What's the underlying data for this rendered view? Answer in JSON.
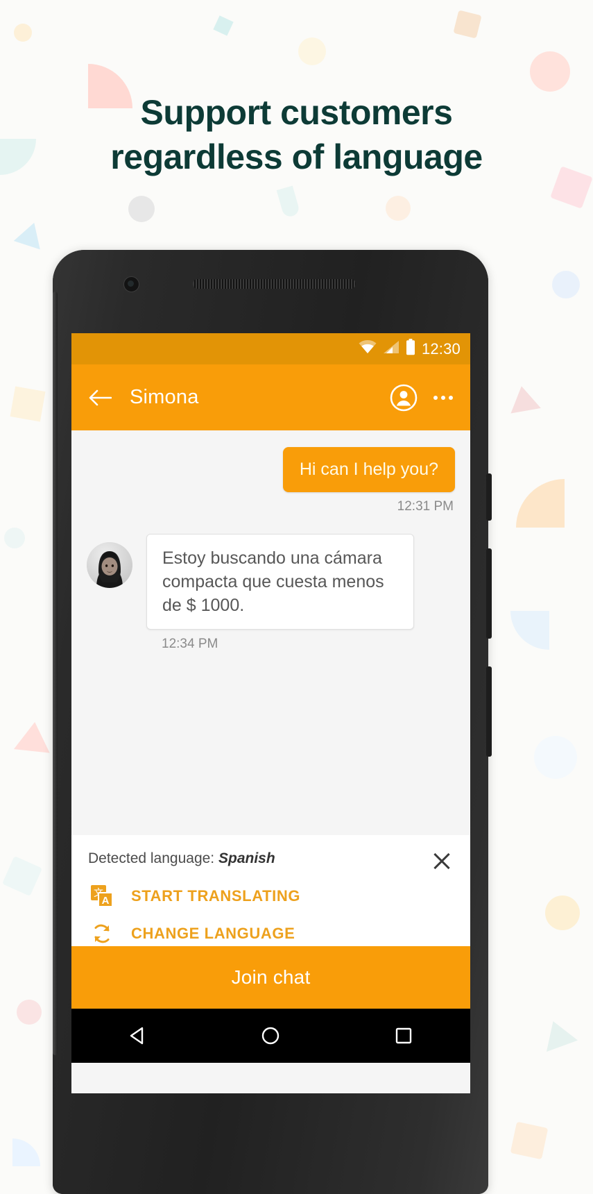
{
  "headline": {
    "line1": "Support customers",
    "line2": "regardless of language",
    "color": "#0d3b36"
  },
  "theme": {
    "accent": "#f99d09",
    "accent_dark": "#e29406",
    "link": "#eda11d",
    "page_bg": "#fbfbf9"
  },
  "phone": {
    "statusbar": {
      "time": "12:30",
      "icons": [
        "wifi-icon",
        "cell-signal-icon",
        "battery-icon"
      ]
    },
    "appbar": {
      "back_icon": "back-arrow-icon",
      "title": "Simona",
      "person_icon": "account-circle-icon",
      "overflow_icon": "more-vertical-icon"
    },
    "chat": {
      "messages": [
        {
          "direction": "outgoing",
          "text": "Hi can I help you?",
          "timestamp": "12:31 PM"
        },
        {
          "direction": "incoming",
          "text": "Estoy buscando una cámara compacta que cuesta menos de $ 1000.",
          "timestamp": "12:34 PM",
          "avatar": "contact-avatar"
        }
      ]
    },
    "translate_panel": {
      "detected_prefix": "Detected language: ",
      "detected_language": "Spanish",
      "close_icon": "close-icon",
      "actions": [
        {
          "icon": "google-translate-icon",
          "label": "START TRANSLATING"
        },
        {
          "icon": "swap-language-icon",
          "label": "CHANGE LANGUAGE"
        }
      ]
    },
    "join_button": "Join chat",
    "navbar": {
      "back_icon": "nav-back-triangle-icon",
      "home_icon": "nav-home-circle-icon",
      "recents_icon": "nav-recents-square-icon"
    }
  }
}
